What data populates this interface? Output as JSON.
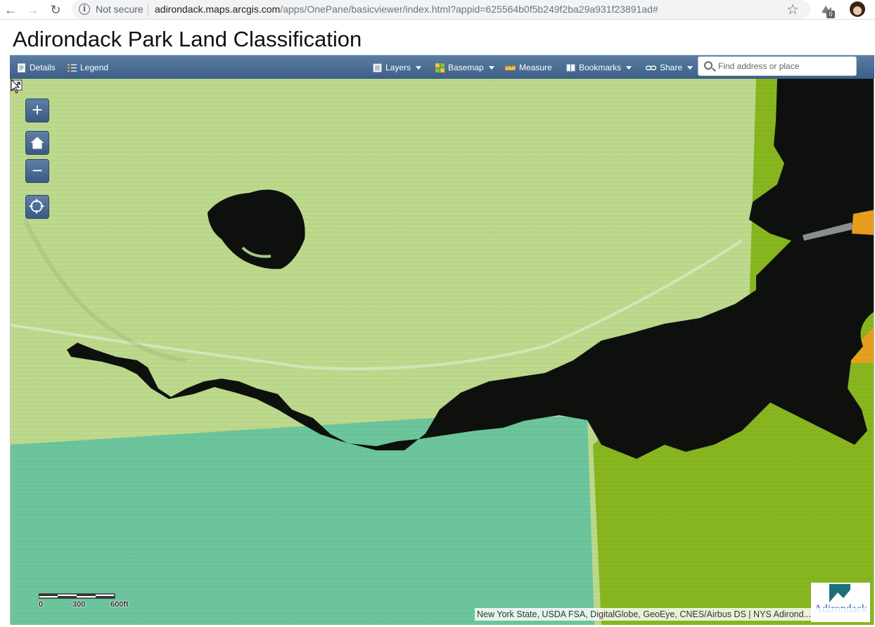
{
  "browser": {
    "security_label": "Not secure",
    "url_host": "adirondack.maps.arcgis.com",
    "url_rest": "/apps/OnePane/basicviewer/index.html?appid=625564b0f5b249f2ba29a931f23891ad#",
    "extension_badge": "0"
  },
  "page": {
    "title": "Adirondack Park Land Classification"
  },
  "toolbar": {
    "details_label": "Details",
    "legend_label": "Legend",
    "layers_label": "Layers",
    "basemap_label": "Basemap",
    "measure_label": "Measure",
    "bookmarks_label": "Bookmarks",
    "share_label": "Share",
    "search_placeholder": "Find address or place",
    "background_color": "#47698f"
  },
  "map": {
    "zoom_in_label": "+",
    "zoom_out_label": "−",
    "scale_labels": [
      "0",
      "300",
      "600ft"
    ],
    "attribution": "New York State, USDA FSA, DigitalGlobe, GeoEye, CNES/Airbus DS | NYS Adirond...",
    "logo_text": "Adirondack",
    "colors": {
      "light_green": "#b9d88a",
      "teal": "#68c49a",
      "bright_green": "#86b51e",
      "orange": "#e8a020",
      "water": "#0c0f0c"
    }
  }
}
